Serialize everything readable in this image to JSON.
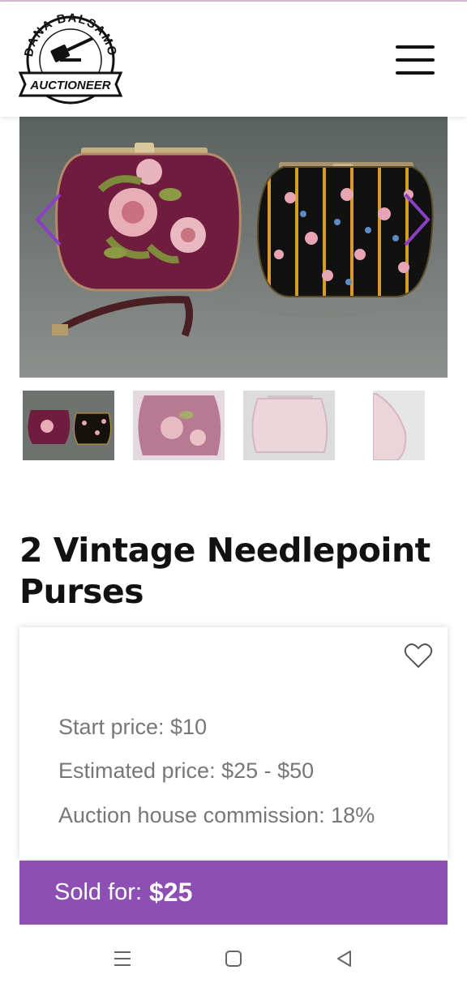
{
  "header": {
    "logo_top": "DANA BALSAMO",
    "logo_bottom": "AUCTIONEER",
    "menu_icon": "hamburger-menu-icon"
  },
  "gallery": {
    "prev_icon": "chevron-left-icon",
    "next_icon": "chevron-right-icon",
    "thumbnails": [
      "both-purses",
      "rose-purse",
      "pink-lining",
      "side-view"
    ]
  },
  "item": {
    "title_line1": "2 Vintage Needlepoint",
    "title_line2": "Purses"
  },
  "details": {
    "favorite_icon": "heart-outline-icon",
    "start_price": "Start price: $10",
    "estimated_price": "Estimated price: $25 - $50",
    "commission": "Auction house commission: 18%"
  },
  "sold": {
    "label": "Sold for:",
    "value": "$25"
  },
  "system_nav": {
    "icons": [
      "recent-apps-icon",
      "home-icon",
      "back-icon"
    ]
  },
  "colors": {
    "accent": "#8e4fb4",
    "carousel_arrow": "#8a3fc4",
    "text_muted": "#777777"
  }
}
